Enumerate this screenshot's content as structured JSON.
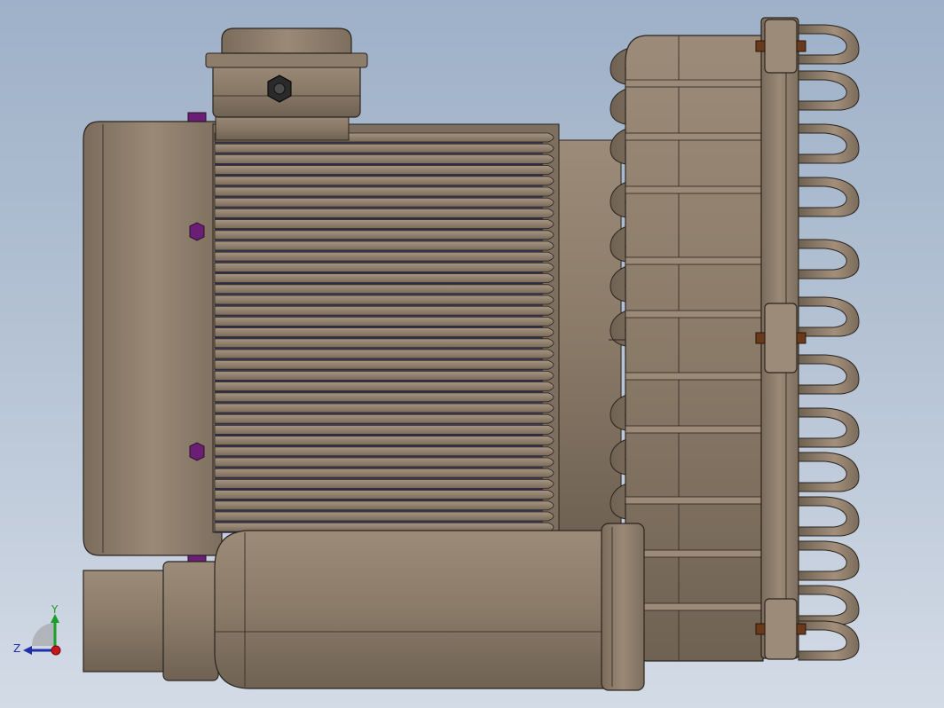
{
  "viewport": {
    "colors": {
      "background_top": "#9eb1c8",
      "background_bottom": "#d3dbe6",
      "metal": "#8a7a68",
      "metal_dark": "#5e5244",
      "metal_light": "#a39280",
      "edge": "#2a241e",
      "fin_slot": "#2b2a55",
      "bolt_purple": "#6b1f74",
      "nut_dark": "#2a2a2a"
    }
  },
  "triad": {
    "y_label": "Y",
    "z_label": "Z",
    "colors": {
      "y": "#1a9e2a",
      "z": "#1f2fa8",
      "x": "#c8161b"
    }
  }
}
